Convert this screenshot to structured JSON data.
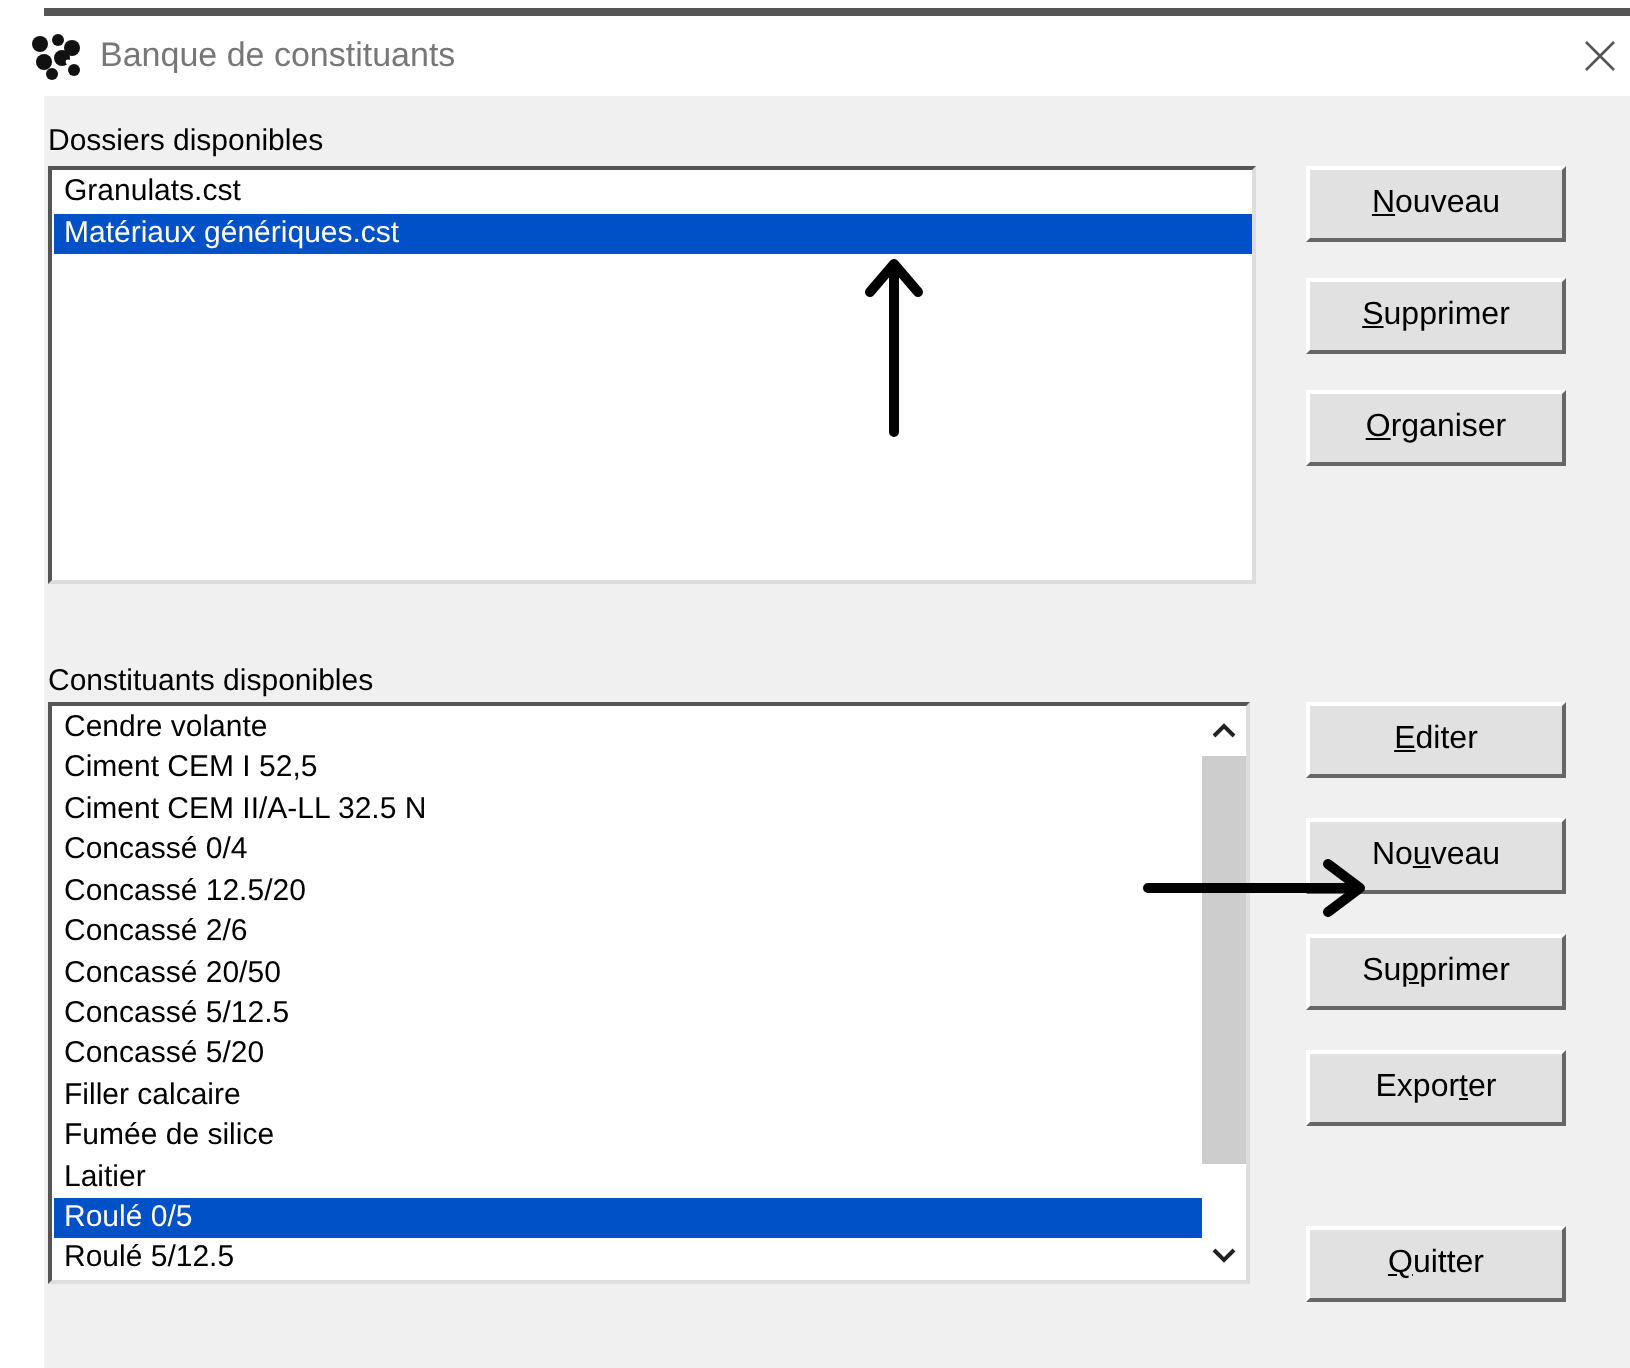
{
  "window": {
    "title": "Banque de constituants"
  },
  "folders": {
    "label": "Dossiers disponibles",
    "items": [
      {
        "text": "Granulats.cst",
        "selected": false
      },
      {
        "text": "Matériaux génériques.cst",
        "selected": true
      }
    ]
  },
  "folder_buttons": [
    {
      "key": "N",
      "after": "ouveau"
    },
    {
      "key": "S",
      "after": "upprimer"
    },
    {
      "key": "O",
      "after": "rganiser"
    }
  ],
  "constituents": {
    "label": "Constituants disponibles",
    "items": [
      {
        "text": "Cendre volante",
        "selected": false
      },
      {
        "text": "Ciment CEM I 52,5",
        "selected": false
      },
      {
        "text": "Ciment CEM II/A-LL 32.5 N",
        "selected": false
      },
      {
        "text": "Concassé 0/4",
        "selected": false
      },
      {
        "text": "Concassé 12.5/20",
        "selected": false
      },
      {
        "text": "Concassé 2/6",
        "selected": false
      },
      {
        "text": "Concassé 20/50",
        "selected": false
      },
      {
        "text": "Concassé 5/12.5",
        "selected": false
      },
      {
        "text": "Concassé 5/20",
        "selected": false
      },
      {
        "text": "Filler calcaire",
        "selected": false
      },
      {
        "text": "Fumée de silice",
        "selected": false
      },
      {
        "text": "Laitier",
        "selected": false
      },
      {
        "text": "Roulé 0/5",
        "selected": true
      },
      {
        "text": "Roulé 5/12.5",
        "selected": false
      }
    ]
  },
  "constituent_buttons": [
    {
      "key": "E",
      "after": "diter"
    },
    {
      "before": "No",
      "key": "u",
      "after": "veau"
    },
    {
      "before": "Su",
      "key": "p",
      "after": "primer"
    },
    {
      "before": "Expor",
      "key": "t",
      "after": "er"
    }
  ],
  "quit_button": {
    "key": "Q",
    "after": "uitter"
  },
  "annotations": [
    {
      "kind": "up"
    },
    {
      "kind": "right"
    }
  ]
}
